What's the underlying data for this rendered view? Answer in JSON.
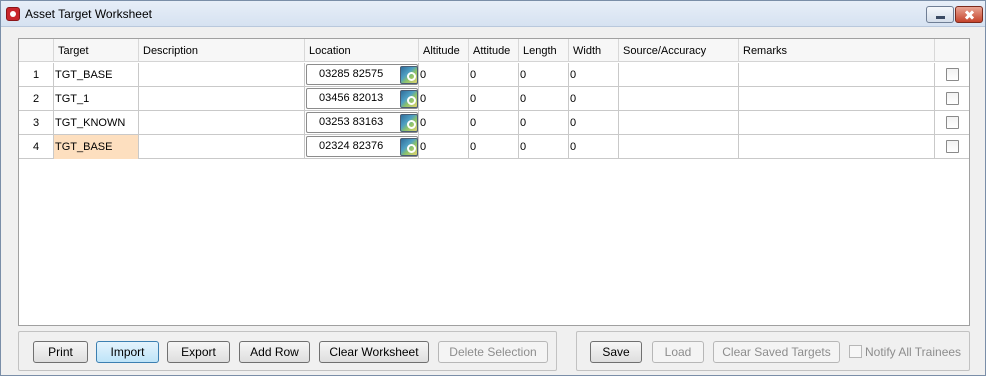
{
  "window": {
    "title": "Asset Target Worksheet"
  },
  "table": {
    "columns": [
      "",
      "Target",
      "Description",
      "Location",
      "Altitude",
      "Attitude",
      "Length",
      "Width",
      "Source/Accuracy",
      "Remarks",
      ""
    ],
    "rows": [
      {
        "num": "1",
        "target": "TGT_BASE",
        "description": "",
        "location": "03285 82575",
        "altitude": "0",
        "attitude": "0",
        "length": "0",
        "width": "0",
        "source": "",
        "remarks": "",
        "checked": false,
        "selected": false
      },
      {
        "num": "2",
        "target": "TGT_1",
        "description": "",
        "location": "03456 82013",
        "altitude": "0",
        "attitude": "0",
        "length": "0",
        "width": "0",
        "source": "",
        "remarks": "",
        "checked": false,
        "selected": false
      },
      {
        "num": "3",
        "target": "TGT_KNOWN",
        "description": "",
        "location": "03253 83163",
        "altitude": "0",
        "attitude": "0",
        "length": "0",
        "width": "0",
        "source": "",
        "remarks": "",
        "checked": false,
        "selected": false
      },
      {
        "num": "4",
        "target": "TGT_BASE",
        "description": "",
        "location": "02324 82376",
        "altitude": "0",
        "attitude": "0",
        "length": "0",
        "width": "0",
        "source": "",
        "remarks": "",
        "checked": false,
        "selected": true
      }
    ]
  },
  "buttons_left": {
    "print": "Print",
    "import": "Import",
    "export": "Export",
    "add_row": "Add Row",
    "clear_worksheet": "Clear Worksheet",
    "delete_selection": "Delete Selection"
  },
  "buttons_right": {
    "save": "Save",
    "load": "Load",
    "clear_saved_targets": "Clear Saved Targets",
    "notify_all_trainees": "Notify All Trainees"
  },
  "icons": {
    "app": "app-icon",
    "location_picker": "map-icon"
  },
  "colors": {
    "selected_cell": "#fddfbf",
    "focused_button": "#bee4f8"
  }
}
